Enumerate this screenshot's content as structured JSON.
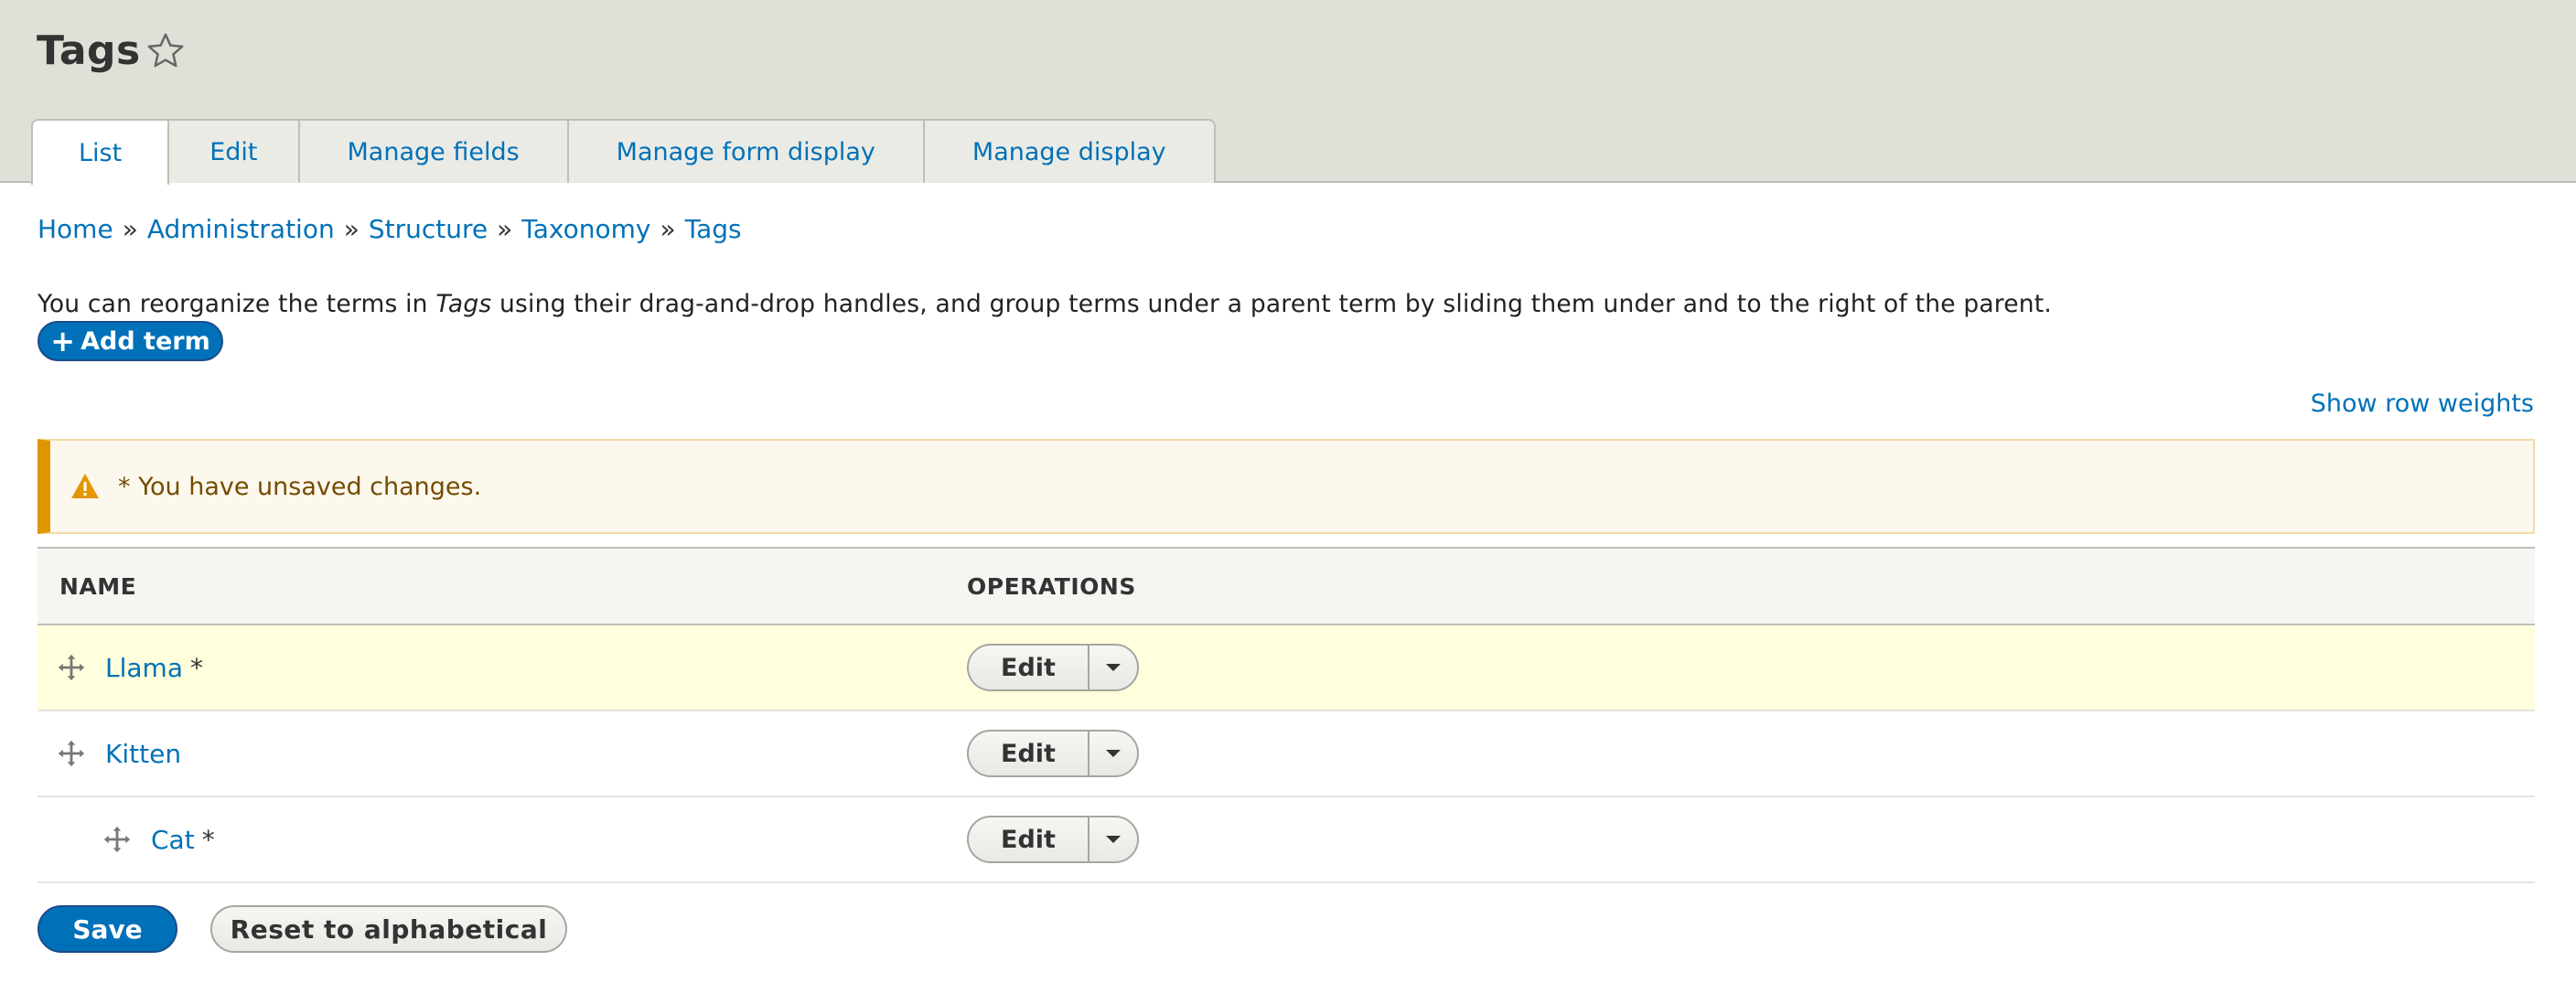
{
  "page": {
    "title": "Tags"
  },
  "tabs": [
    {
      "label": "List",
      "active": true
    },
    {
      "label": "Edit",
      "active": false
    },
    {
      "label": "Manage fields",
      "active": false
    },
    {
      "label": "Manage form display",
      "active": false
    },
    {
      "label": "Manage display",
      "active": false
    }
  ],
  "breadcrumb": {
    "items": [
      "Home",
      "Administration",
      "Structure",
      "Taxonomy",
      "Tags"
    ],
    "separator": "»"
  },
  "help": {
    "before": "You can reorganize the terms in ",
    "emphasis": "Tags",
    "after": " using their drag-and-drop handles, and group terms under a parent term by sliding them under and to the right of the parent."
  },
  "actions": {
    "add_term_plus": "+",
    "add_term_label": "Add term",
    "show_row_weights": "Show row weights",
    "save_label": "Save",
    "reset_label": "Reset to alphabetical"
  },
  "warning": {
    "message": "* You have unsaved changes.",
    "icon": "warning-triangle-icon",
    "accent_color": "#e09600"
  },
  "table": {
    "headers": {
      "name": "NAME",
      "operations": "OPERATIONS"
    },
    "rows": [
      {
        "name": "Llama",
        "marker": "*",
        "depth": 0,
        "changed": true,
        "edit_label": "Edit"
      },
      {
        "name": "Kitten",
        "marker": "",
        "depth": 0,
        "changed": false,
        "edit_label": "Edit"
      },
      {
        "name": "Cat",
        "marker": "*",
        "depth": 1,
        "changed": false,
        "edit_label": "Edit"
      }
    ]
  },
  "colors": {
    "link": "#0071b8",
    "primary_button": "#0071b8",
    "changed_row": "#ffffdd",
    "header_bg": "#e0e0d8"
  }
}
